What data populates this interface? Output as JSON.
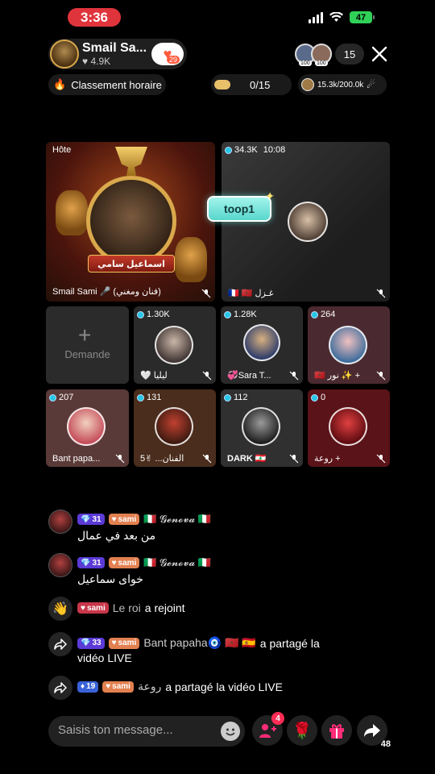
{
  "status": {
    "time": "3:36",
    "battery": "47"
  },
  "host": {
    "name": "Smail Sa...",
    "likes": "4.9K",
    "follow_badge": "29"
  },
  "viewers": {
    "count": "15",
    "badge": "100"
  },
  "ranking_label": "Classement horaire",
  "goal_progress": "0/15",
  "coins_progress": "15.3k/200.0k",
  "host_tile": {
    "label": "Hôte",
    "banner": "اسماعيل سامي",
    "name": "Smail Sami 🎤 (فنان ومغني)"
  },
  "guest_tile": {
    "count": "34.3K",
    "time": "10:08",
    "name": "🇫🇷 🇲🇦 غـزل"
  },
  "toop_label": "toop1",
  "add_tile": {
    "plus": "+",
    "label": "Demande"
  },
  "guests": [
    {
      "count": "1.30K",
      "name": "🤍 ليليا",
      "color": "#3b3b3b"
    },
    {
      "count": "1.28K",
      "name": "💞Sara T...",
      "color": "#3a3a3a"
    },
    {
      "count": "264",
      "name": "🇲🇦 نور ✨ +",
      "color": "#4a2a30"
    },
    {
      "count": "207",
      "name": "Bant papa...",
      "color": "#5a3a38"
    },
    {
      "count": "131",
      "name": "الفنان... ✌5",
      "color": "#4a2d1d"
    },
    {
      "count": "112",
      "name": "DARK 🇱🇧",
      "color": "#303030"
    },
    {
      "count": "0",
      "name": "روعة +",
      "color": "#5a1318"
    }
  ],
  "chat": [
    {
      "level": "31",
      "badge": "sami",
      "user": "🇮🇹 𝓖𝓮𝓷𝓸𝓿𝓪 🇮🇹",
      "text": "من بعد في عمال"
    },
    {
      "level": "31",
      "badge": "sami",
      "user": "🇮🇹 𝓖𝓮𝓷𝓸𝓿𝓪 🇮🇹",
      "text": "خواى سماعيل"
    }
  ],
  "join_msg": {
    "badge": "sami",
    "user": "Le roi",
    "action": "a rejoint"
  },
  "share_msg_1": {
    "level": "33",
    "badge": "sami",
    "user": "Bant papaha🧿 🇲🇦 🇪🇸",
    "action": "a partagé la",
    "action2": "vidéo LIVE"
  },
  "share_msg_2": {
    "level": "19",
    "badge": "sami",
    "user": "روعة",
    "action": "a partagé la vidéo LIVE"
  },
  "input": {
    "placeholder": "Saisis ton message..."
  },
  "bottom": {
    "requests_badge": "4",
    "share_count": "48"
  },
  "colors": {
    "accent_red": "#e0343c",
    "teal": "#27c7e6",
    "battery": "#30d158"
  }
}
